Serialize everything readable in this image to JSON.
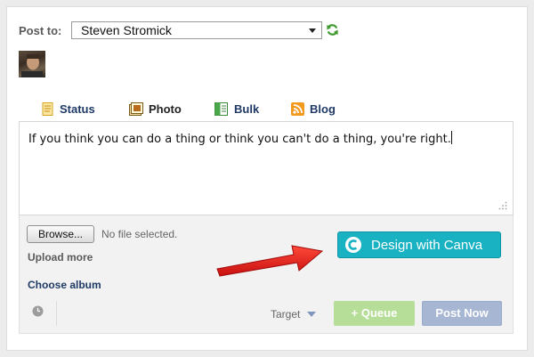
{
  "post_to": {
    "label": "Post to:",
    "selected_account": "Steven Stromick"
  },
  "tabs": [
    {
      "label": "Status",
      "icon": "status-icon",
      "active": false
    },
    {
      "label": "Photo",
      "icon": "photo-icon",
      "active": true
    },
    {
      "label": "Bulk",
      "icon": "bulk-icon",
      "active": false
    },
    {
      "label": "Blog",
      "icon": "rss-icon",
      "active": false
    }
  ],
  "composer": {
    "text": "If you think you can do a thing or think you can't do a thing, you're right."
  },
  "upload": {
    "browse_label": "Browse...",
    "file_status": "No file selected.",
    "upload_more": "Upload more",
    "choose_album": "Choose album"
  },
  "canva": {
    "label": "Design with Canva",
    "color": "#19b2c3"
  },
  "footer": {
    "target_label": "Target",
    "queue_label": "+ Queue",
    "post_now_label": "Post Now"
  },
  "colors": {
    "queue": "#b6de98",
    "post_now": "#a6b6d3",
    "arrow": "#e01818",
    "link": "#1f3a66"
  }
}
